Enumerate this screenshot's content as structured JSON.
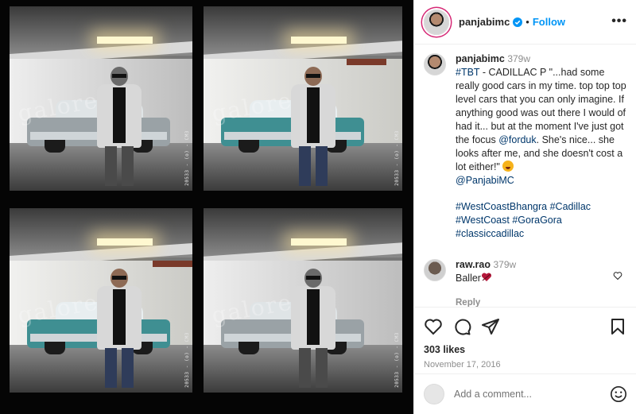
{
  "post": {
    "username": "panjabimc",
    "follow_label": "Follow",
    "separator": "•",
    "more_label": "•••"
  },
  "image": {
    "film_marks": [
      "20533 - (o) - CM3",
      "20533 - (o) - CM3",
      "20533 - (o) - CM3",
      "20533 - (o) - CM3"
    ],
    "watermark": "galore"
  },
  "caption": {
    "username": "panjabimc",
    "age": "379w",
    "hashtag1": "#TBT",
    "text": " - CADILLAC P \"...had some really good cars in my time. top top top level cars that you can only imagine. If anything good was out there I would of had it... but at the moment I've just got the focus ",
    "mention_forduk": "@forduk",
    "text2": ". She's nice... she looks after me, and she doesn't cost a lot either!\" ",
    "mention_panjabimc": "@PanjabiMC",
    "tags": [
      "#WestCoastBhangra",
      "#Cadillac",
      "#WestCoast",
      "#GoraGora",
      "#classiccadillac"
    ]
  },
  "comment": {
    "username": "raw.rao",
    "age": "379w",
    "text": "Baller",
    "reply_label": "Reply"
  },
  "actions": {
    "likes": "303 likes",
    "date": "November 17, 2016"
  },
  "add_comment": {
    "placeholder": "Add a comment..."
  },
  "colors": {
    "accent": "#0095f6",
    "link": "#00376b",
    "muted": "#8e8e8e"
  }
}
